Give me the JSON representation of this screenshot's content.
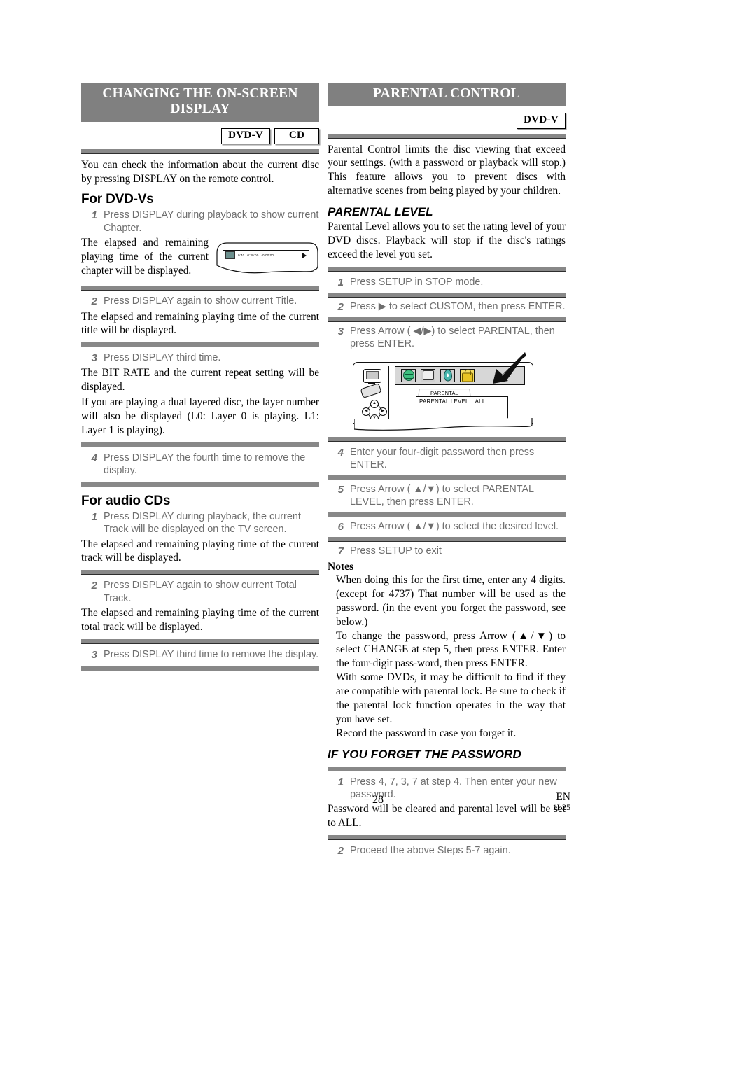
{
  "left_column": {
    "section_title_line1": "CHANGING THE ON-SCREEN",
    "section_title_line2": "DISPLAY",
    "badges": [
      "DVD-V",
      "CD"
    ],
    "intro": "You can check the information about the current disc by pressing DISPLAY on the remote control.",
    "dvd_heading": "For DVD-Vs",
    "dvd_steps": [
      {
        "num": "1",
        "text": "Press DISPLAY during playback to show current Chapter."
      },
      {
        "num": "2",
        "text": "Press DISPLAY again to show current Title."
      },
      {
        "num": "3",
        "text": "Press DISPLAY third time."
      },
      {
        "num": "4",
        "text": "Press DISPLAY the fourth time to remove the display."
      }
    ],
    "dvd_body_1": "The elapsed and remaining playing time of the current chapter will be displayed.",
    "dvd_body_2": "The elapsed and remaining playing time of the current title will be displayed.",
    "dvd_body_3": "The BIT RATE and the current repeat setting will be displayed.",
    "dvd_body_4": "If you are playing a dual layered disc, the layer number will also be displayed (L0: Layer 0 is playing. L1: Layer 1 is playing).",
    "cd_heading": "For audio CDs",
    "cd_steps": [
      {
        "num": "1",
        "text": "Press DISPLAY during playback, the current Track will be displayed on the TV screen."
      },
      {
        "num": "2",
        "text": "Press DISPLAY again to show current Total Track."
      },
      {
        "num": "3",
        "text": "Press DISPLAY third time to remove the display."
      }
    ],
    "cd_body_1": "The elapsed and remaining playing time of the current track will be displayed.",
    "cd_body_2": "The elapsed and remaining playing time of the current total track will be displayed.",
    "osd_figure": {
      "chapter_label": "0:40",
      "elapsed_time": "0:30:00",
      "remaining_time": "-0:00:00",
      "play_icon": "play-triangle-icon"
    }
  },
  "right_column": {
    "section_title": "PARENTAL CONTROL",
    "badges": [
      "DVD-V"
    ],
    "intro": "Parental Control limits the disc viewing that exceed your settings. (with a password or playback will stop.) This feature allows you to prevent discs with alternative scenes from being played by your children.",
    "parental_level_heading": "PARENTAL LEVEL",
    "parental_level_intro": "Parental Level allows you to set the rating level of your DVD discs. Playback will stop if the disc's ratings exceed the level you set.",
    "steps": [
      {
        "num": "1",
        "text": "Press SETUP in STOP mode."
      },
      {
        "num": "2",
        "text": "Press ▶ to select CUSTOM, then press ENTER."
      },
      {
        "num": "3",
        "text": "Press Arrow ( ◀/▶) to select PARENTAL, then press ENTER."
      },
      {
        "num": "4",
        "text": "Enter your four-digit password then press ENTER."
      },
      {
        "num": "5",
        "text": "Press Arrow ( ▲/▼) to select PARENTAL LEVEL, then press ENTER."
      },
      {
        "num": "6",
        "text": "Press Arrow ( ▲/▼) to select the desired level."
      },
      {
        "num": "7",
        "text": "Press SETUP to exit"
      }
    ],
    "setup_figure": {
      "icons": [
        "globe-icon",
        "display-icon",
        "disc-icon",
        "lock-icon"
      ],
      "selected_icon": "lock-icon",
      "tab_label": "PARENTAL",
      "menu_row_label": "PARENTAL LEVEL",
      "menu_row_value": "ALL",
      "pointer": "arrow-pointer-icon"
    },
    "notes_heading": "Notes",
    "notes": [
      "When doing this for the first time, enter any 4 digits. (except for 4737) That number will be used as the password. (in the event you forget the password, see below.)",
      "To change the password, press Arrow (▲/▼) to select CHANGE at step 5, then press ENTER. Enter the four-digit pass-word, then press ENTER.",
      "With some DVDs, it may be difficult to find if they are compatible with parental lock. Be sure to check if the parental lock function operates in the way that you have set.",
      "Record the password in case you forget it."
    ],
    "forget_heading": "IF YOU FORGET THE PASSWORD",
    "forget_steps": [
      {
        "num": "1",
        "text": "Press 4, 7, 3, 7 at step 4. Then enter your new password."
      },
      {
        "num": "2",
        "text": "Proceed the above Steps 5-7 again."
      }
    ],
    "forget_body": "Password will be cleared and parental level will be set to ALL."
  },
  "footer": {
    "page_number": "− 28 −",
    "language_code": "EN",
    "doc_code": "1L25"
  },
  "colors": {
    "header_bar": "#808080",
    "rule": "#888888",
    "step_text": "#6e6e6e"
  }
}
